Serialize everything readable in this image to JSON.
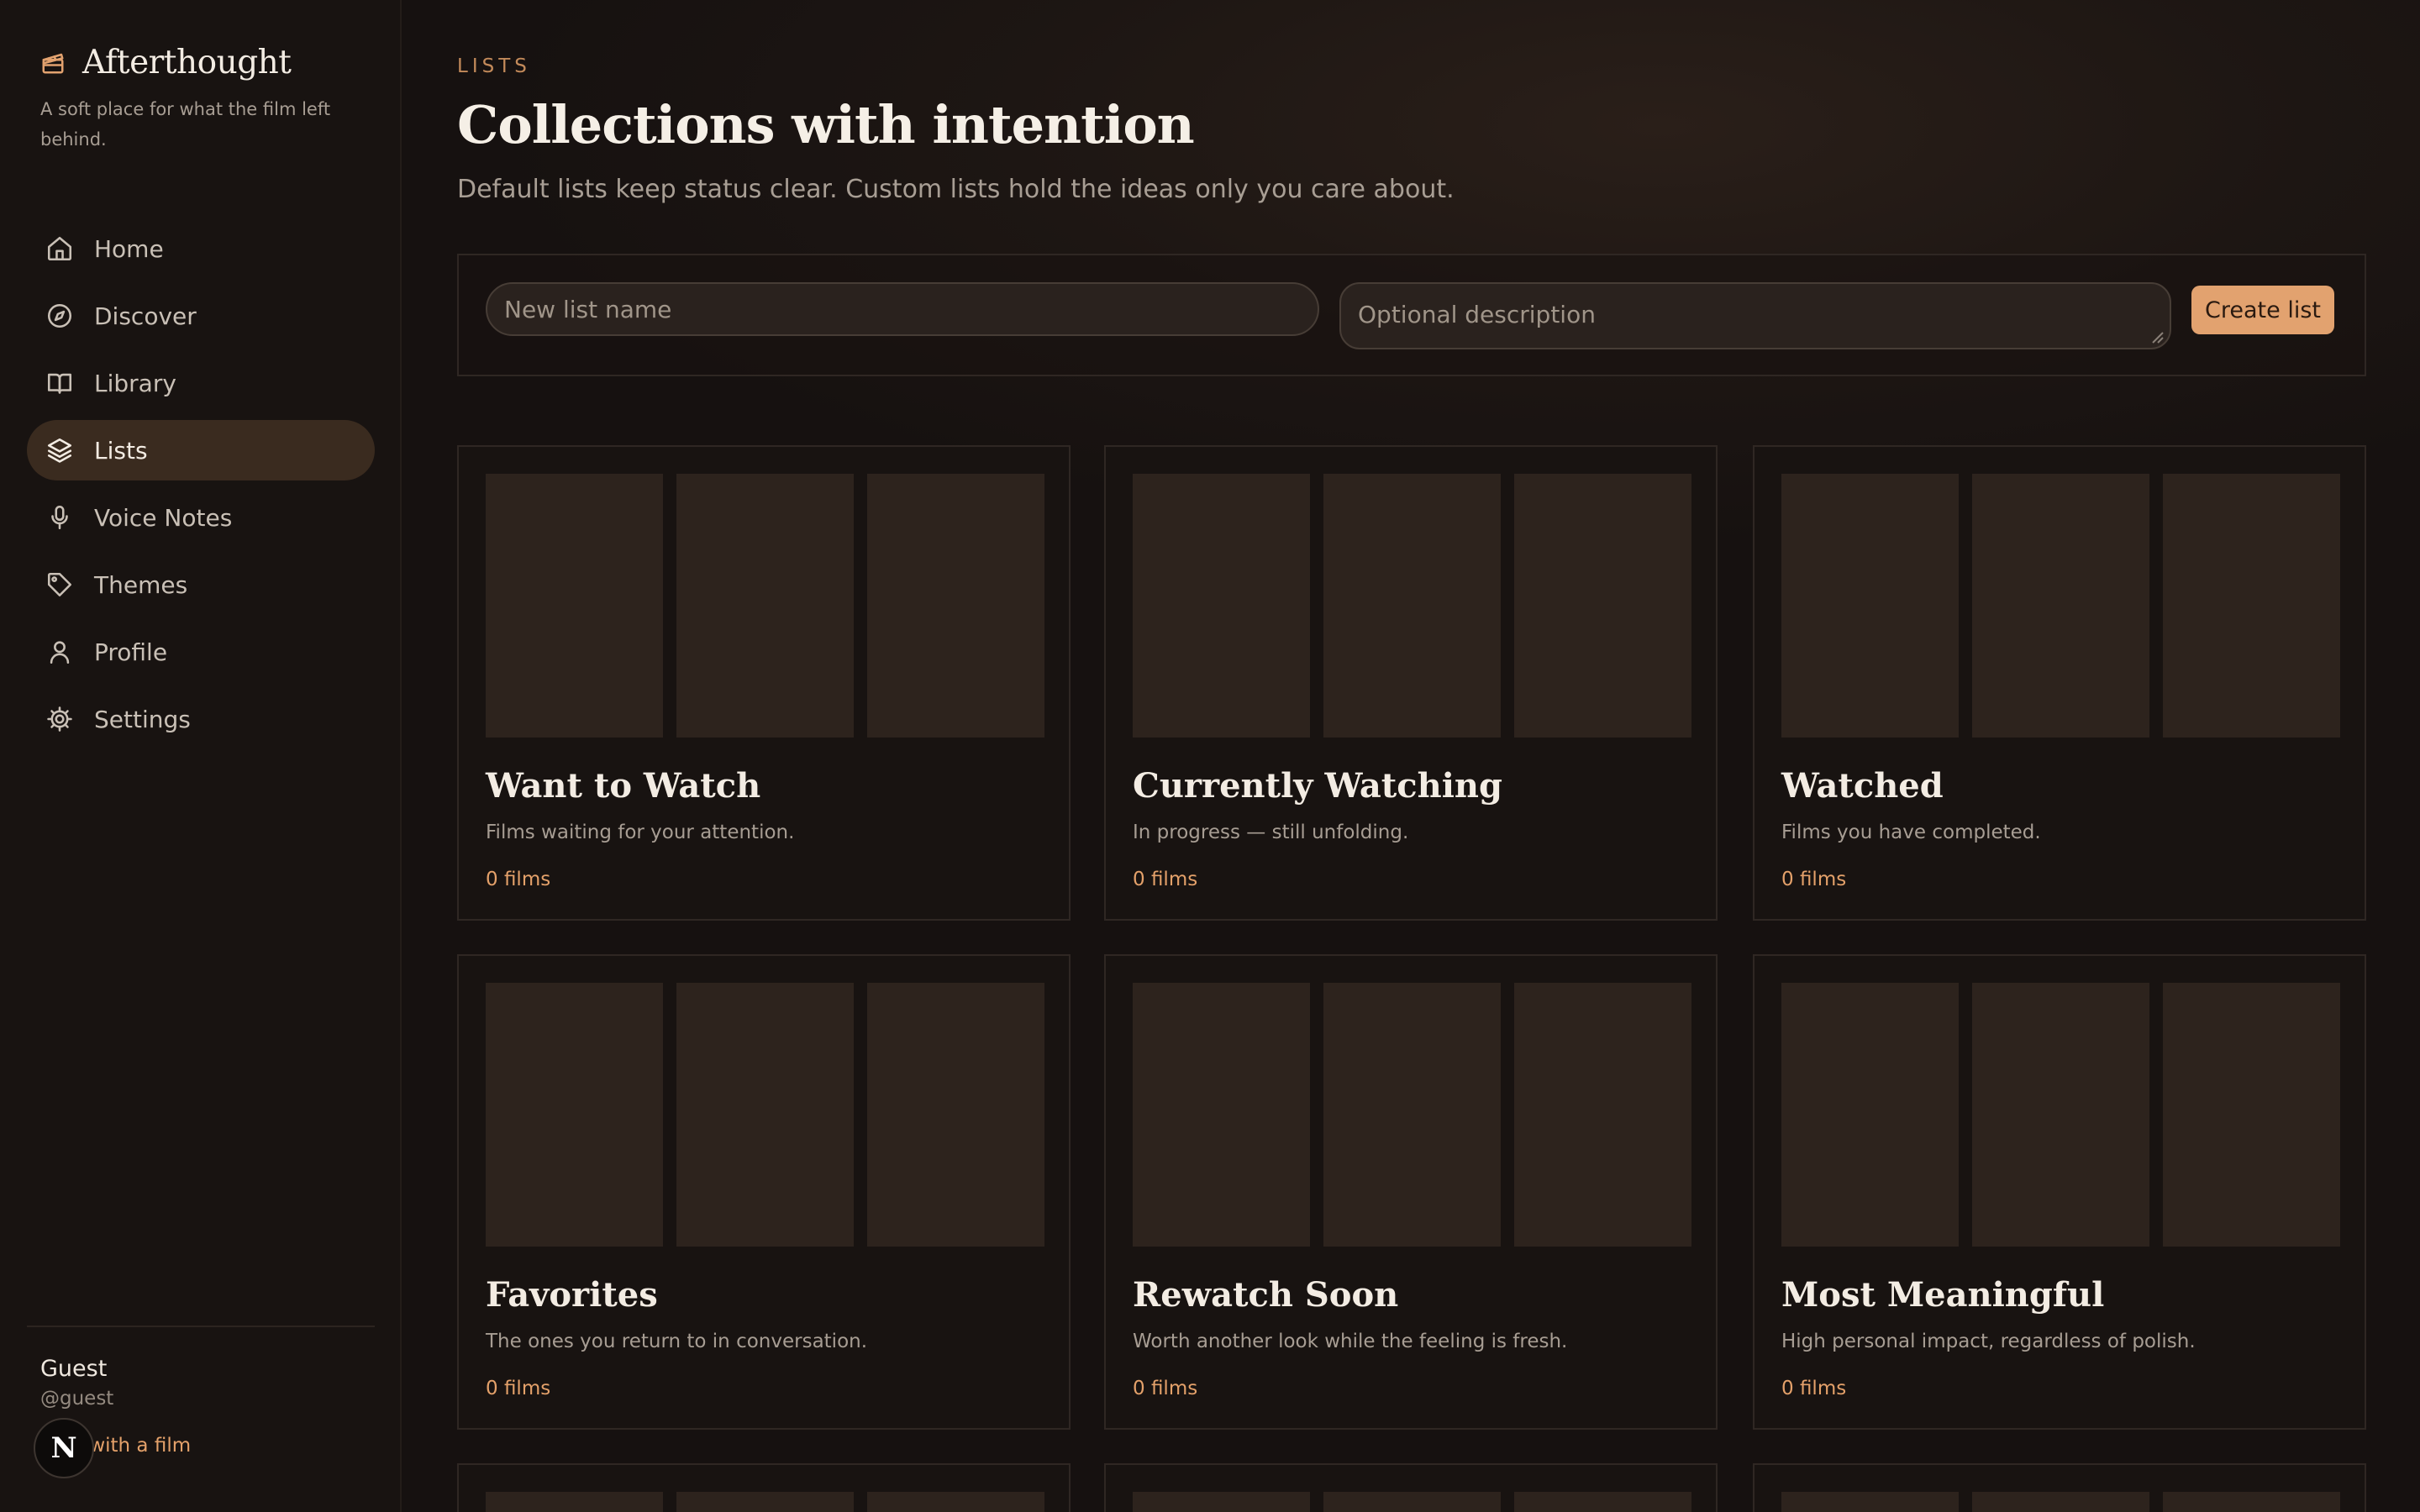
{
  "brand": {
    "name": "Afterthought",
    "tagline": "A soft place for what the film left behind."
  },
  "nav": {
    "items": [
      {
        "label": "Home",
        "icon": "home-icon"
      },
      {
        "label": "Discover",
        "icon": "compass-icon"
      },
      {
        "label": "Library",
        "icon": "book-icon"
      },
      {
        "label": "Lists",
        "icon": "layers-icon",
        "active": true
      },
      {
        "label": "Voice Notes",
        "icon": "microphone-icon"
      },
      {
        "label": "Themes",
        "icon": "tag-icon"
      },
      {
        "label": "Profile",
        "icon": "user-icon"
      },
      {
        "label": "Settings",
        "icon": "gear-icon"
      }
    ]
  },
  "user": {
    "name": "Guest",
    "handle": "@guest",
    "chat_link": "t with a film",
    "badge_letter": "N"
  },
  "header": {
    "eyebrow": "LISTS",
    "title": "Collections with intention",
    "subtitle": "Default lists keep status clear. Custom lists hold the ideas only you care about."
  },
  "create_form": {
    "name_placeholder": "New list name",
    "description_placeholder": "Optional description",
    "button_label": "Create list"
  },
  "lists": [
    {
      "title": "Want to Watch",
      "description": "Films waiting for your attention.",
      "count": "0 films"
    },
    {
      "title": "Currently Watching",
      "description": "In progress — still unfolding.",
      "count": "0 films"
    },
    {
      "title": "Watched",
      "description": "Films you have completed.",
      "count": "0 films"
    },
    {
      "title": "Favorites",
      "description": "The ones you return to in conversation.",
      "count": "0 films"
    },
    {
      "title": "Rewatch Soon",
      "description": "Worth another look while the feeling is fresh.",
      "count": "0 films"
    },
    {
      "title": "Most Meaningful",
      "description": "High personal impact, regardless of polish.",
      "count": "0 films"
    }
  ],
  "colors": {
    "accent": "#e2a26f",
    "accent_text": "#e4a16a",
    "background": "#161110",
    "active_nav": "#3a2b1f",
    "poster_placeholder": "#2d231d"
  }
}
